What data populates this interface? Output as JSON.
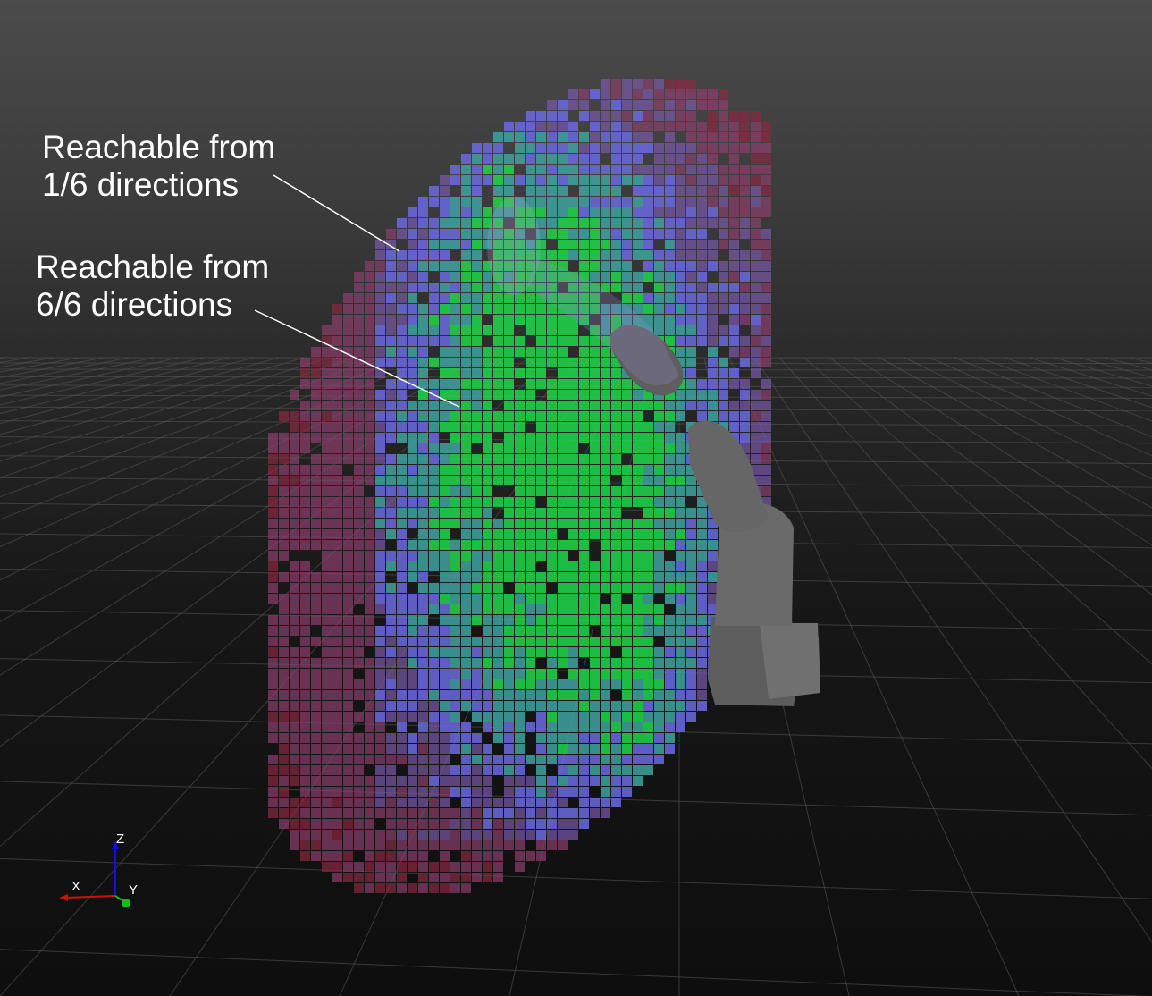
{
  "annotations": {
    "one_direction": {
      "line1": "Reachable from",
      "line2": "1/6 directions"
    },
    "six_directions": {
      "line1": "Reachable from",
      "line2": "6/6 directions"
    }
  },
  "axis_gizmo": {
    "z_label": "Z",
    "x_label": "X",
    "y_label": "Y"
  },
  "colors": {
    "reach_1_of_6": "#8a2a42",
    "reach_2_of_6": "#8d3f6e",
    "reach_3_of_6": "#7b5aa8",
    "reach_4_of_6": "#6a6ae0",
    "reach_5_of_6": "#3fa3a0",
    "reach_6_of_6": "#1fd84a",
    "axis_x": "#d01010",
    "axis_y": "#10c010",
    "axis_z": "#1010e0",
    "robot": "#6b6b6b"
  }
}
